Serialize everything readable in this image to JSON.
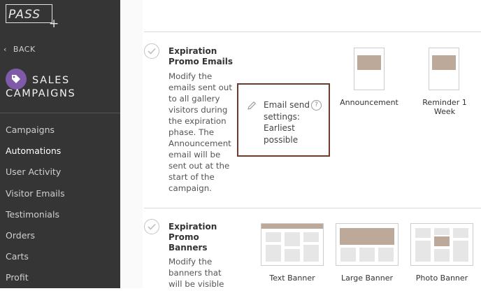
{
  "sidebar": {
    "logo_text": "PASS",
    "logo_plus": "+",
    "back_label": "BACK",
    "campaign_title_line1": "SALES",
    "campaign_title_line2": "CAMPAIGNS",
    "nav": [
      {
        "label": "Campaigns"
      },
      {
        "label": "Automations",
        "active": true
      },
      {
        "label": "User Activity"
      },
      {
        "label": "Visitor Emails"
      },
      {
        "label": "Testimonials"
      },
      {
        "label": "Orders"
      },
      {
        "label": "Carts"
      },
      {
        "label": "Profit"
      }
    ]
  },
  "sections": [
    {
      "title_line1": "Expiration",
      "title_line2": "Promo Emails",
      "description_lines": [
        "Modify the",
        "emails sent out",
        "to all gallery",
        "visitors during",
        "the expiration",
        "phase. The",
        "Announcement",
        "email will be",
        "sent out at the",
        "start of the",
        "campaign."
      ],
      "settings_lines": [
        "Email send",
        "settings:",
        "Earliest",
        "possible"
      ],
      "thumbnails": [
        {
          "label": "Announcement"
        },
        {
          "label": "Reminder 1 Week"
        }
      ]
    },
    {
      "title_line1": "Expiration",
      "title_line2": "Promo",
      "title_line3": "Banners",
      "description_lines": [
        "Modify the",
        "banners that",
        "will be visible"
      ],
      "thumbnails": [
        {
          "label": "Text Banner"
        },
        {
          "label": "Large Banner"
        },
        {
          "label": "Photo Banner"
        }
      ]
    }
  ],
  "colors": {
    "sidebar_bg": "#353535",
    "accent_purple": "#7e5aa8",
    "highlight_border": "#6e3b2e",
    "thumb_brown": "#bda99a"
  }
}
